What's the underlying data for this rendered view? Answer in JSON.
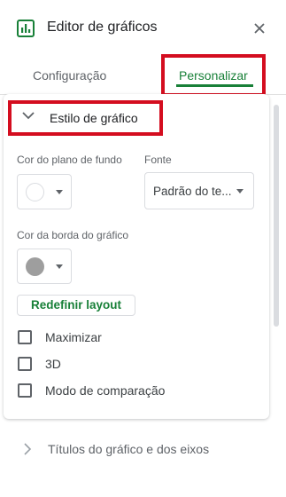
{
  "header": {
    "title": "Editor de gráficos",
    "icon": "chart-icon",
    "close_icon": "close-icon"
  },
  "tabs": [
    {
      "label": "Configuração",
      "active": false
    },
    {
      "label": "Personalizar",
      "active": true
    }
  ],
  "section": {
    "title": "Estilo de gráfico",
    "expanded": true,
    "background_color_label": "Cor do plano de fundo",
    "background_color": "#ffffff",
    "font_label": "Fonte",
    "font_value": "Padrão do te...",
    "border_color_label": "Cor da borda do gráfico",
    "border_color": "#9e9e9e",
    "reset_button": "Redefinir layout",
    "checkboxes": [
      {
        "label": "Maximizar",
        "checked": false
      },
      {
        "label": "3D",
        "checked": false
      },
      {
        "label": "Modo de comparação",
        "checked": false
      }
    ]
  },
  "next_section": {
    "title": "Títulos do gráfico e dos eixos",
    "expanded": false
  },
  "colors": {
    "accent": "#188038",
    "highlight": "#d40d1f"
  }
}
